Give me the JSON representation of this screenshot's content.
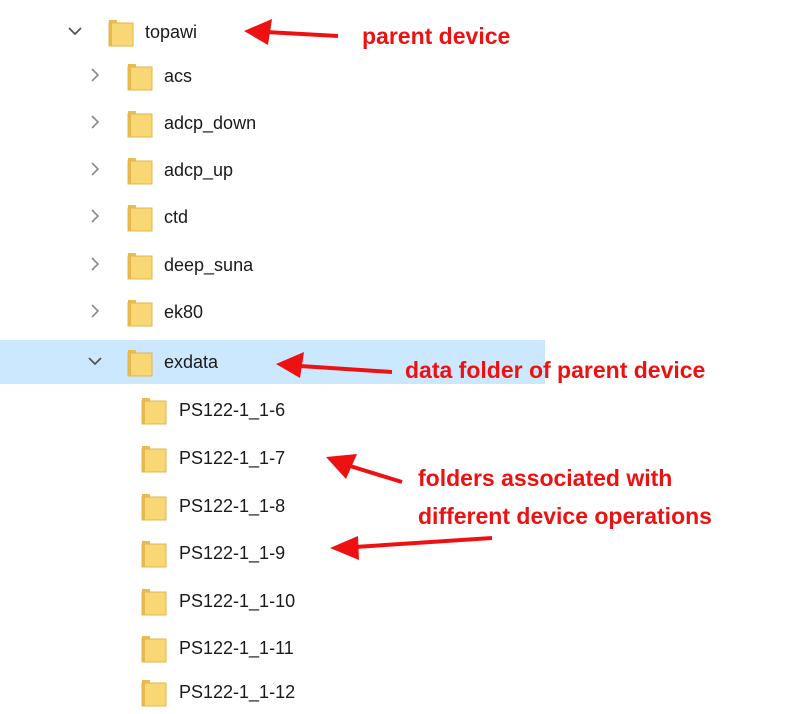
{
  "tree": {
    "parent": {
      "label": "topawi",
      "expanded": true,
      "chevron_icon": "chevron-down-icon",
      "folder_icon": "folder-icon"
    },
    "children": [
      {
        "label": "acs",
        "chevron_icon": "chevron-right-icon"
      },
      {
        "label": "adcp_down",
        "chevron_icon": "chevron-right-icon"
      },
      {
        "label": "adcp_up",
        "chevron_icon": "chevron-right-icon"
      },
      {
        "label": "ctd",
        "chevron_icon": "chevron-right-icon"
      },
      {
        "label": "deep_suna",
        "chevron_icon": "chevron-right-icon"
      },
      {
        "label": "ek80",
        "chevron_icon": "chevron-right-icon"
      }
    ],
    "selected": {
      "label": "exdata",
      "expanded": true,
      "selected": true,
      "chevron_icon": "chevron-down-icon"
    },
    "operations": [
      {
        "label": "PS122-1_1-6"
      },
      {
        "label": "PS122-1_1-7"
      },
      {
        "label": "PS122-1_1-8"
      },
      {
        "label": "PS122-1_1-9"
      },
      {
        "label": "PS122-1_1-10"
      },
      {
        "label": "PS122-1_1-11"
      },
      {
        "label": "PS122-1_1-12"
      }
    ]
  },
  "annotations": {
    "parent_device": "parent device",
    "data_folder": "data folder of parent device",
    "operations_line1": "folders associated with",
    "operations_line2": "different device operations"
  },
  "colors": {
    "annotation": "#ee1111",
    "selection": "#cce8ff",
    "folder_fill": "#f9d775",
    "folder_edge": "#e0b74a",
    "chevron": "#7a7a7a"
  }
}
